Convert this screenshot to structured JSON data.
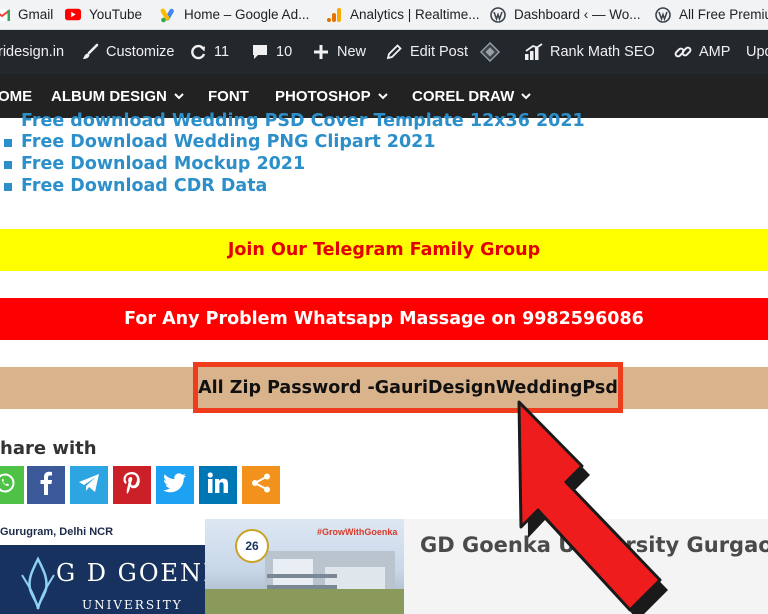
{
  "bookmarks": [
    {
      "label": "Gmail",
      "icon": "gmail-icon"
    },
    {
      "label": "YouTube",
      "icon": "youtube-icon"
    },
    {
      "label": "Home – Google Ad...",
      "icon": "google-ads-icon"
    },
    {
      "label": "Analytics | Realtime...",
      "icon": "analytics-icon"
    },
    {
      "label": "Dashboard ‹ — Wo...",
      "icon": "wordpress-icon"
    },
    {
      "label": "All Free Premiu",
      "icon": "wordpress-icon"
    }
  ],
  "admin_bar": {
    "site": "ridesign.in",
    "customize": "Customize",
    "updates": "11",
    "comments": "10",
    "new": "New",
    "edit_post": "Edit Post",
    "rank_math": "Rank Math SEO",
    "amp": "AMP",
    "updates_trunc": "Upd"
  },
  "site_nav": {
    "home": "OME",
    "album_design": "ALBUM DESIGN",
    "font": "FONT",
    "photoshop": "PHOTOSHOP",
    "corel_draw": "COREL DRAW"
  },
  "links": [
    "Free download Wedding PSD Cover Template 12x36 2021",
    "Free Download Wedding PNG Clipart 2021",
    "Free Download Mockup 2021",
    "Free Download CDR Data"
  ],
  "telegram_text": "Join Our Telegram Family Group",
  "whatsapp_text": "For Any Problem Whatsapp Massage on 9982596086",
  "password_text": "All Zip Password -GauriDesignWeddingPsd",
  "share_label": "hare with",
  "share_buttons": [
    {
      "name": "whatsapp",
      "color": "#4dc247"
    },
    {
      "name": "facebook",
      "color": "#3b5998"
    },
    {
      "name": "telegram",
      "color": "#2ca5e0"
    },
    {
      "name": "pinterest",
      "color": "#cb2027"
    },
    {
      "name": "twitter",
      "color": "#1da1f2"
    },
    {
      "name": "linkedin",
      "color": "#0077b5"
    },
    {
      "name": "more",
      "color": "#f2911b"
    }
  ],
  "ad": {
    "location": "Gurugram, Delhi NCR",
    "name": "G D GOENKA",
    "university": "UNIVERSITY",
    "hashtag": "#GrowWithGoenka",
    "seal": "26"
  },
  "card_title": "GD Goenka University Gurgao",
  "colors": {
    "link_blue": "#2c8fc9",
    "telegram_bg": "#ffff00",
    "telegram_fg": "#e30000",
    "whatsapp_bg": "#ff0000",
    "password_bg": "#d9b38c",
    "password_border": "#ee3c1d",
    "arrow_red": "#ee1c1c"
  }
}
